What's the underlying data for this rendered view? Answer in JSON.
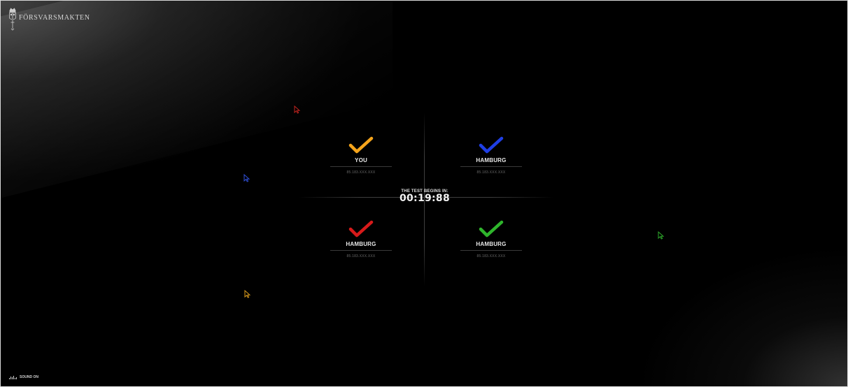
{
  "brand": {
    "logo_icon": "crown-emblem-icon",
    "name": "FÖRSVARSMAKTEN"
  },
  "countdown": {
    "label": "THE TEST BEGINS IN:",
    "time": "00:19:88"
  },
  "participants": [
    {
      "name": "YOU",
      "ip": "85.183.XXX.XXX",
      "color": "#f5a41b",
      "icon": "checkmark-icon"
    },
    {
      "name": "HAMBURG",
      "ip": "85.183.XXX.XXX",
      "color": "#1f3fe6",
      "icon": "checkmark-icon"
    },
    {
      "name": "HAMBURG",
      "ip": "85.183.XXX.XXX",
      "color": "#d71a1a",
      "icon": "checkmark-icon"
    },
    {
      "name": "HAMBURG",
      "ip": "85.183.XXX.XXX",
      "color": "#2fb52c",
      "icon": "checkmark-icon"
    }
  ],
  "cursors": [
    {
      "color": "#c0241f",
      "icon": "arrow-cursor-icon"
    },
    {
      "color": "#2f4fd6",
      "icon": "arrow-cursor-icon"
    },
    {
      "color": "#2ea82b",
      "icon": "arrow-cursor-icon"
    },
    {
      "color": "#d99a1c",
      "icon": "arrow-cursor-icon"
    }
  ],
  "sound": {
    "label": "SOUND ON",
    "icon": "sound-bars-icon"
  }
}
